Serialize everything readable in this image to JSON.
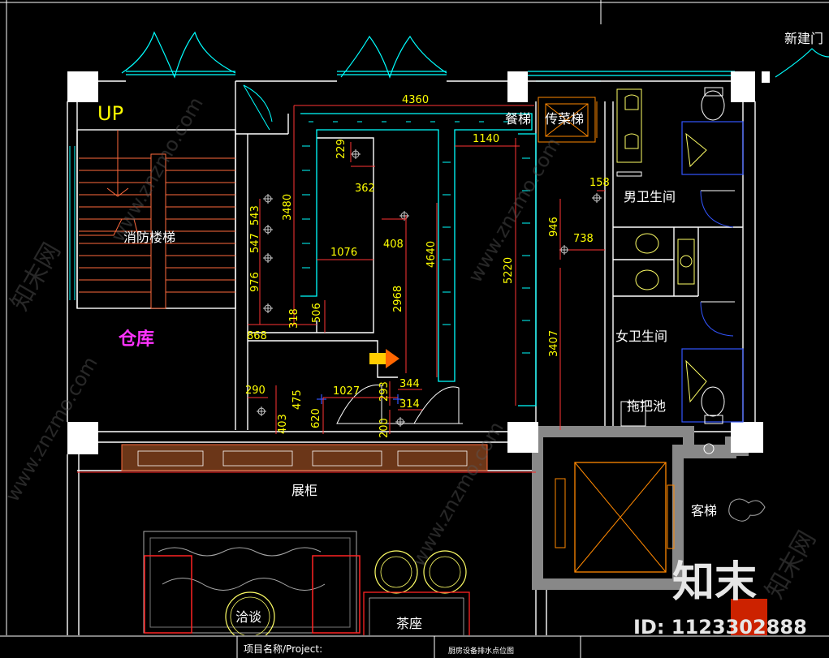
{
  "rooms": {
    "stair_up": "UP",
    "fire_stair": "消防楼梯",
    "warehouse": "仓库",
    "dish_lift": "餐梯",
    "serving_lift": "传菜梯",
    "mens_toilet": "男卫生间",
    "womens_toilet": "女卫生间",
    "mop_sink": "拖把池",
    "new_door": "新建门",
    "display_cabinet": "展柜",
    "passenger_lift": "客梯",
    "negotiation": "洽谈",
    "tea_seat": "茶座"
  },
  "dimensions": {
    "d4360": "4360",
    "d1140": "1140",
    "d229": "229",
    "d362": "362",
    "d3480": "3480",
    "d543": "543",
    "d547": "547",
    "d976": "976",
    "d1076": "1076",
    "d408": "408",
    "d4640": "4640",
    "d5220": "5220",
    "d946": "946",
    "d158": "158",
    "d738": "738",
    "d2968": "2968",
    "d318": "318",
    "d506": "506",
    "d868": "868",
    "d3407": "3407",
    "d290": "290",
    "d475": "475",
    "d403": "403",
    "d620": "620",
    "d1027": "1027",
    "d293": "293",
    "d344": "344",
    "d314": "314",
    "d200": "200"
  },
  "title_block": {
    "project_label": "项目名称/Project:",
    "drawing_title": "厨房设备排水点位图"
  },
  "watermark": {
    "brand": "知末",
    "id_text": "ID: 1123302888",
    "diag_text": "www.znzmo.com",
    "side_text": "知末网"
  },
  "colors": {
    "wall": "#ffffff",
    "dimension": "#ffff00",
    "cabinet": "#00ffff",
    "window": "#00ffff",
    "furniture": "#ffff66",
    "lift": "#ff8800",
    "fixture": "#3355ff",
    "display_fill": "#7a3a1a",
    "warehouse_text": "#ff33ff"
  }
}
